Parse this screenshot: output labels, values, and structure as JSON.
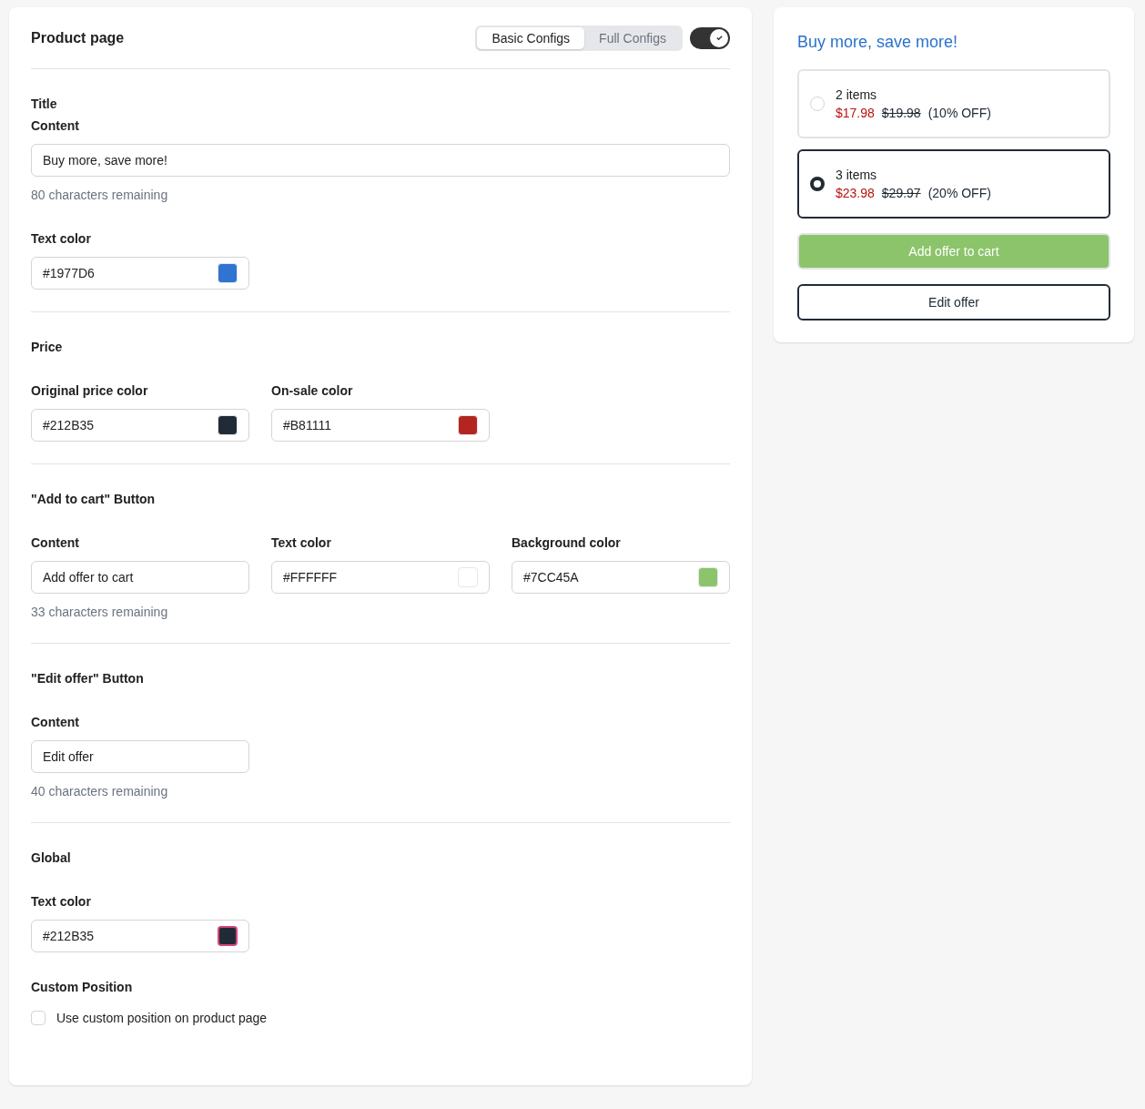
{
  "editor": {
    "title": "Product page",
    "tabs": [
      {
        "label": "Basic Configs",
        "selected": true
      },
      {
        "label": "Full Configs",
        "selected": false
      }
    ],
    "toggle": {
      "on": true
    },
    "sections": [
      {
        "title": "Title",
        "rows": [
          {
            "fields": [
              {
                "kind": "wide_text",
                "label": "Content",
                "value": "Buy more, save more!",
                "remaining": "80 characters remaining"
              }
            ]
          },
          {
            "fields": [
              {
                "kind": "color",
                "label": "Text color",
                "value": "#1977D6",
                "color": "#3173d0",
                "focused": false
              }
            ]
          }
        ]
      },
      {
        "title": "Price",
        "rows": [
          {
            "fields": [
              {
                "kind": "color",
                "label": "Original price color",
                "value": "#212B35",
                "color": "#212b35",
                "focused": false
              },
              {
                "kind": "color",
                "label": "On-sale color",
                "value": "#B81111",
                "color": "#b32620",
                "focused": false
              }
            ]
          }
        ]
      },
      {
        "title": "\"Add to cart\" Button",
        "rows": [
          {
            "fields": [
              {
                "kind": "text",
                "label": "Content",
                "value": "Add offer to cart",
                "remaining": "33 characters remaining"
              },
              {
                "kind": "color",
                "label": "Text color",
                "value": "#FFFFFF",
                "color": "#ffffff",
                "focused": false
              },
              {
                "kind": "color",
                "label": "Background color",
                "value": "#7CC45A",
                "color": "#8bc46a",
                "focused": false
              }
            ]
          }
        ]
      },
      {
        "title": "\"Edit offer\" Button",
        "rows": [
          {
            "fields": [
              {
                "kind": "text",
                "label": "Content",
                "value": "Edit offer",
                "remaining": "40 characters remaining"
              }
            ]
          }
        ]
      },
      {
        "title": "Global",
        "rows": [
          {
            "fields": [
              {
                "kind": "color",
                "label": "Text color",
                "value": "#212B35",
                "color": "#212b35",
                "focused": true
              }
            ]
          },
          {
            "fields": [
              {
                "kind": "checkbox",
                "label": "Custom Position",
                "option": "Use custom position on product page",
                "checked": false
              }
            ]
          }
        ]
      }
    ]
  },
  "preview": {
    "title": "Buy more, save more!",
    "options": [
      {
        "quantity": "2 items",
        "sale_price": "$17.98",
        "original_price": "$19.98",
        "discount": "(10% OFF)",
        "selected": false
      },
      {
        "quantity": "3 items",
        "sale_price": "$23.98",
        "original_price": "$29.97",
        "discount": "(20% OFF)",
        "selected": true
      }
    ],
    "add_button": {
      "label": "Add offer to cart"
    },
    "edit_button": {
      "label": "Edit offer"
    }
  }
}
